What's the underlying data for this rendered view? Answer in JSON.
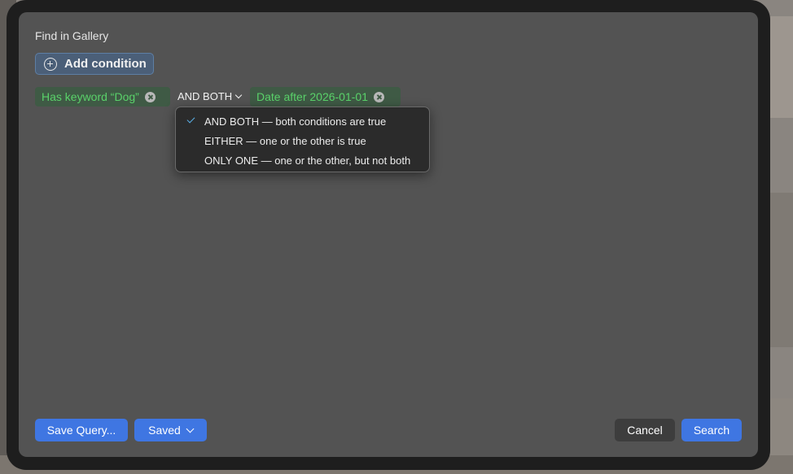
{
  "dialog": {
    "title": "Find in Gallery",
    "add_condition_label": "Add condition"
  },
  "conditions": [
    {
      "label": "Has keyword “Dog”"
    },
    {
      "label": "Date after 2026-01-01"
    }
  ],
  "operator": {
    "selected_label": "AND BOTH",
    "options": [
      {
        "label": "AND BOTH — both conditions are true",
        "selected": true
      },
      {
        "label": "EITHER — one or the other is true",
        "selected": false
      },
      {
        "label": "ONLY ONE — one or the other, but not both",
        "selected": false
      }
    ]
  },
  "footer": {
    "save_query_label": "Save Query...",
    "saved_label": "Saved",
    "cancel_label": "Cancel",
    "search_label": "Search"
  },
  "colors": {
    "accent": "#3f76e2",
    "token_text": "#5ad26a",
    "check": "#5ab0e8"
  },
  "icons": {
    "add": "plus-circle-icon",
    "remove": "x-circle-icon",
    "dropdown": "chevron-down-icon",
    "selected": "checkmark-icon"
  }
}
